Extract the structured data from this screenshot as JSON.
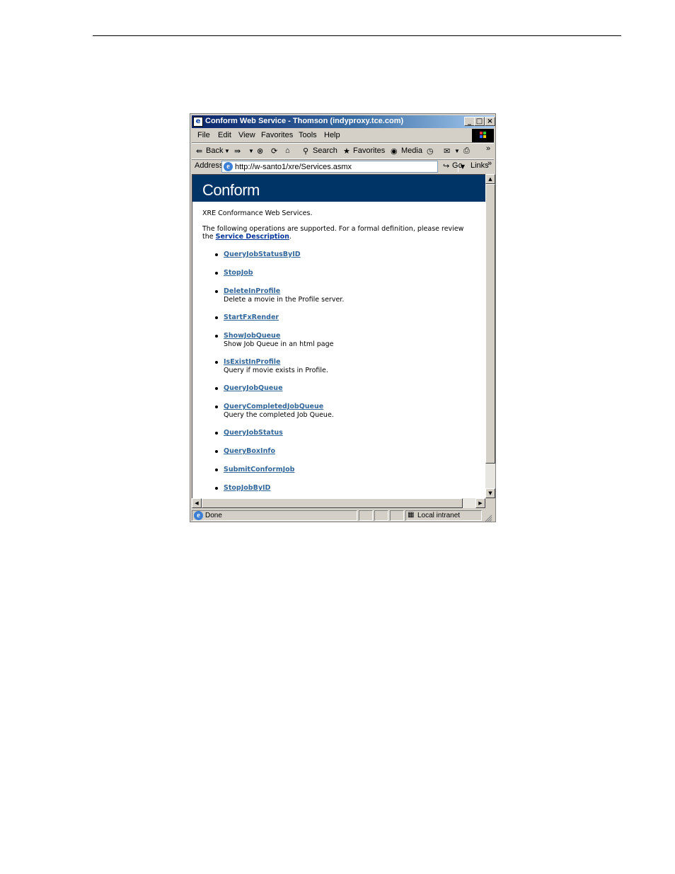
{
  "window": {
    "title": "Conform Web Service - Thomson (indyproxy.tce.com)",
    "min": "_",
    "max": "□",
    "close": "×"
  },
  "menu": [
    "File",
    "Edit",
    "View",
    "Favorites",
    "Tools",
    "Help"
  ],
  "toolbar": {
    "back": "Back",
    "search": "Search",
    "favorites": "Favorites",
    "media": "Media",
    "more": "»"
  },
  "address": {
    "label": "Address",
    "url": "http://w-santo1/xre/Services.asmx",
    "go": "Go",
    "links": "Links",
    "more": "»"
  },
  "page": {
    "title": "Conform",
    "intro": "XRE Conformance Web Services.",
    "ops_line1": "The following operations are supported. For a formal definition, please review",
    "ops_line2_prefix": "the ",
    "service_link": "Service Description",
    "ops_line2_suffix": ".",
    "operations": [
      {
        "name": "QueryJobStatusByID",
        "desc": ""
      },
      {
        "name": "StopJob",
        "desc": ""
      },
      {
        "name": "DeleteInProfile",
        "desc": "Delete a movie in the Profile server."
      },
      {
        "name": "StartFxRender",
        "desc": ""
      },
      {
        "name": "ShowJobQueue",
        "desc": "Show Job Queue in an html page"
      },
      {
        "name": "IsExistInProfile",
        "desc": "Query if movie exists in Profile."
      },
      {
        "name": "QueryJobQueue",
        "desc": ""
      },
      {
        "name": "QueryCompletedJobQueue",
        "desc": "Query the completed Job Queue."
      },
      {
        "name": "QueryJobStatus",
        "desc": ""
      },
      {
        "name": "QueryBoxInfo",
        "desc": ""
      },
      {
        "name": "SubmitConformJob",
        "desc": ""
      },
      {
        "name": "StopJobByID",
        "desc": ""
      }
    ]
  },
  "status": {
    "text": "Done",
    "zone": "Local intranet"
  }
}
